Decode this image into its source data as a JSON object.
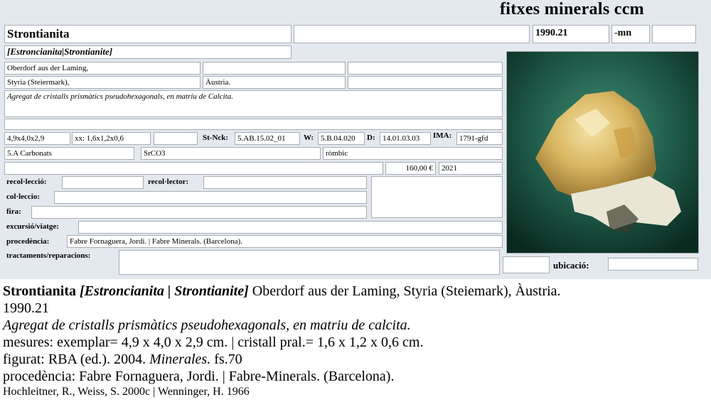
{
  "app": {
    "title": "fitxes minerals ccm"
  },
  "record": {
    "name": "Strontianita",
    "extra_field": "",
    "code": "1990.21",
    "suffix": "-mn",
    "suffix_extra": "",
    "synonyms": "[Estroncianita|Strontianite]",
    "locality": "Oberdorf aus der Laming,",
    "locality_extra1": "",
    "locality_extra2": "",
    "region": "Styria (Steiermark),",
    "country": "Àustria.",
    "region_extra": "",
    "description": "Agregat de cristalls prismàtics pseudohexagonals, en matriu de Calcita.",
    "description_extra": "",
    "size_specimen": "4,9x4,0x2,9",
    "size_crystal": "xx: 1,6x1,2x0,6",
    "size_extra": "",
    "strunz_label": "St-Nck:",
    "strunz_value": "5.AB.15.02_01",
    "w_label": "W:",
    "w_value": "5.B.04.020",
    "d_label": "D:",
    "d_value": "14.01.03.03",
    "ima_label": "IMA:",
    "ima_value": "1791-gfd",
    "class": "5.A Carbonats",
    "formula": "SrCO3",
    "system": "ròmbic",
    "notes_field": "",
    "price": "160,00 €",
    "year": "2021",
    "collection_label": "recol·lecció:",
    "collection_value": "",
    "collector_label": "recol·lector:",
    "collector_value": "",
    "coll_label": "col·leccio:",
    "coll_value": "",
    "fair_label": "fira:",
    "fair_value": "",
    "trip_label": "excursió/viatge:",
    "trip_value": "",
    "provenance_label": "procedència:",
    "provenance_value": "Fabre Fornaguera, Jordi. | Fabre Minerals. (Barcelona).",
    "treatments_label": "tractaments/reparacions:",
    "treatments_value": "",
    "location_box": "",
    "location_label": "ubicació:",
    "location_value": ""
  },
  "summary": {
    "name": "Strontianita",
    "synonyms": "[Estroncianita | Strontianite]",
    "locality": "Oberdorf aus der Laming, Styria (Steiemark), Àustria.",
    "code": "1990.21",
    "description": "Agregat de cristalls prismàtics pseudohexagonals, en matriu de calcita.",
    "measures": "mesures: exemplar= 4,9 x 4,0 x 2,9 cm. | cristall pral.= 1,6 x 1,2 x 0,6 cm.",
    "figured_prefix": "figurat: RBA (ed.). 2004.",
    "figured_title": "Minerales.",
    "figured_suffix": "fs.70",
    "provenance": "procedència: Fabre Fornaguera, Jordi. | Fabre-Minerals. (Barcelona).",
    "references": "Hochleitner, R., Weiss, S. 2000c | Wenninger, H. 1966"
  },
  "colors": {
    "form_bg": "#e4e8ef",
    "field_border": "#a9adb3",
    "photo_bg": "#1e4e3c"
  },
  "icons": {
    "photo": "mineral-specimen-photo"
  }
}
